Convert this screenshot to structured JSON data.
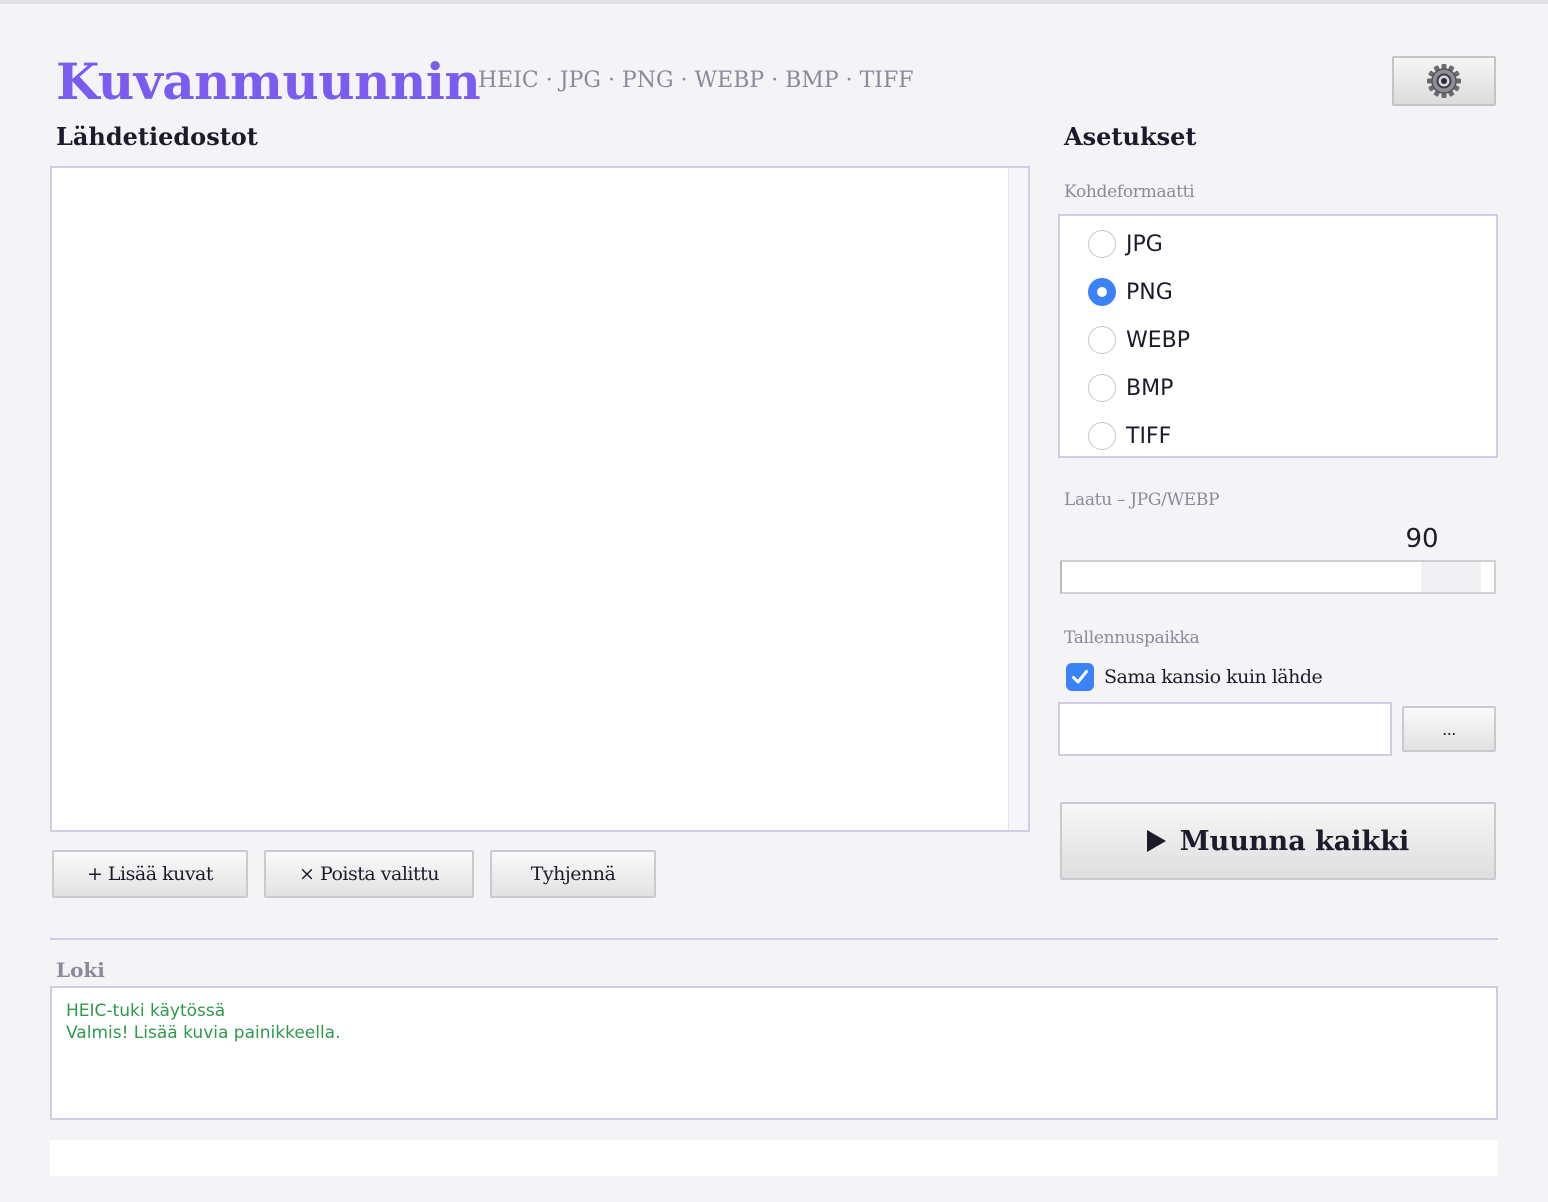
{
  "header": {
    "title": "Kuvanmuunnin",
    "subtitle": "HEIC · JPG · PNG · WEBP · BMP · TIFF",
    "settings_icon": "gear-icon"
  },
  "sources": {
    "heading": "Lähdetiedostot",
    "files": [],
    "buttons": {
      "add": "+ Lisää kuvat",
      "remove": "× Poista valittu",
      "clear": "Tyhjennä"
    }
  },
  "settings": {
    "heading": "Asetukset",
    "format_label": "Kohdeformaatti",
    "formats": [
      {
        "label": "JPG",
        "checked": false
      },
      {
        "label": "PNG",
        "checked": true
      },
      {
        "label": "WEBP",
        "checked": false
      },
      {
        "label": "BMP",
        "checked": false
      },
      {
        "label": "TIFF",
        "checked": false
      }
    ],
    "quality_label": "Laatu – JPG/WEBP",
    "quality_value": "90",
    "quality_min": 0,
    "quality_max": 100,
    "save_label": "Tallennuspaikka",
    "same_folder_label": "Sama kansio kuin lähde",
    "same_folder_checked": true,
    "path_value": "",
    "browse_label": "...",
    "convert_label": "Muunna kaikki"
  },
  "log": {
    "heading": "Loki",
    "lines": [
      "HEIC-tuki käytössä",
      "Valmis! Lisää kuvia painikkeella."
    ]
  },
  "status": "",
  "colors": {
    "accent": "#7a5cf0",
    "control_blue": "#3b82f6",
    "log_green": "#2e9a4a",
    "border": "#cfcce6"
  }
}
